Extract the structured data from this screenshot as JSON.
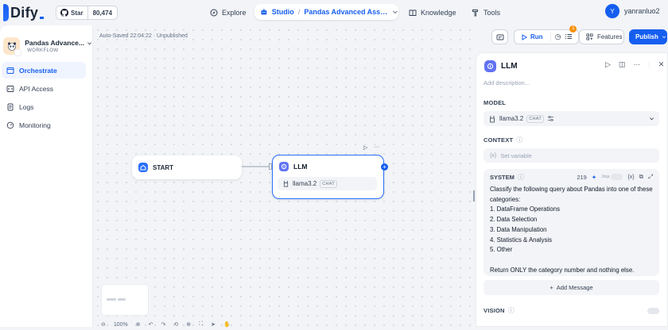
{
  "topbar": {
    "brand": "Dify",
    "github": {
      "star_label": "Star",
      "star_count": "80,474"
    },
    "nav": {
      "explore": "Explore",
      "studio": "Studio",
      "app_name": "Pandas Advanced Assist...",
      "knowledge": "Knowledge",
      "tools": "Tools"
    },
    "user": {
      "initial": "Y",
      "name": "yanranluo2"
    }
  },
  "sidebar": {
    "app_name": "Pandas Advance...",
    "app_type": "WORKFLOW",
    "items": [
      {
        "label": "Orchestrate",
        "active": true
      },
      {
        "label": "API Access",
        "active": false
      },
      {
        "label": "Logs",
        "active": false
      },
      {
        "label": "Monitoring",
        "active": false
      }
    ]
  },
  "canvas": {
    "autosave": "Auto-Saved 22:04:22 · Unpublished",
    "start_node": {
      "label": "START"
    },
    "llm_node": {
      "label": "LLM",
      "model": "llama3.2",
      "badge": "CHAT"
    },
    "zoom": "100%"
  },
  "toolbar": {
    "run": "Run",
    "badge_count": "1",
    "features": "Features",
    "publish": "Publish"
  },
  "panel": {
    "title": "LLM",
    "description_placeholder": "Add description...",
    "model_label": "MODEL",
    "model_name": "llama3.2",
    "model_badge": "CHAT",
    "context_label": "CONTEXT",
    "context_placeholder": "Set variable",
    "system": {
      "label": "SYSTEM",
      "token_count": "219",
      "jinja_label": "Jinja",
      "lines": [
        "Classify the following query about Pandas into one of these",
        "categories:",
        "1. DataFrame Operations",
        "2. Data Selection",
        "3. Data Manipulation",
        "4. Statistics & Analysis",
        "5. Other",
        "",
        "Return ONLY the category number and nothing else."
      ]
    },
    "add_message": "Add Message",
    "vision_label": "VISION"
  },
  "colors": {
    "accent": "#155eef",
    "orange_badge": "#f79009"
  }
}
